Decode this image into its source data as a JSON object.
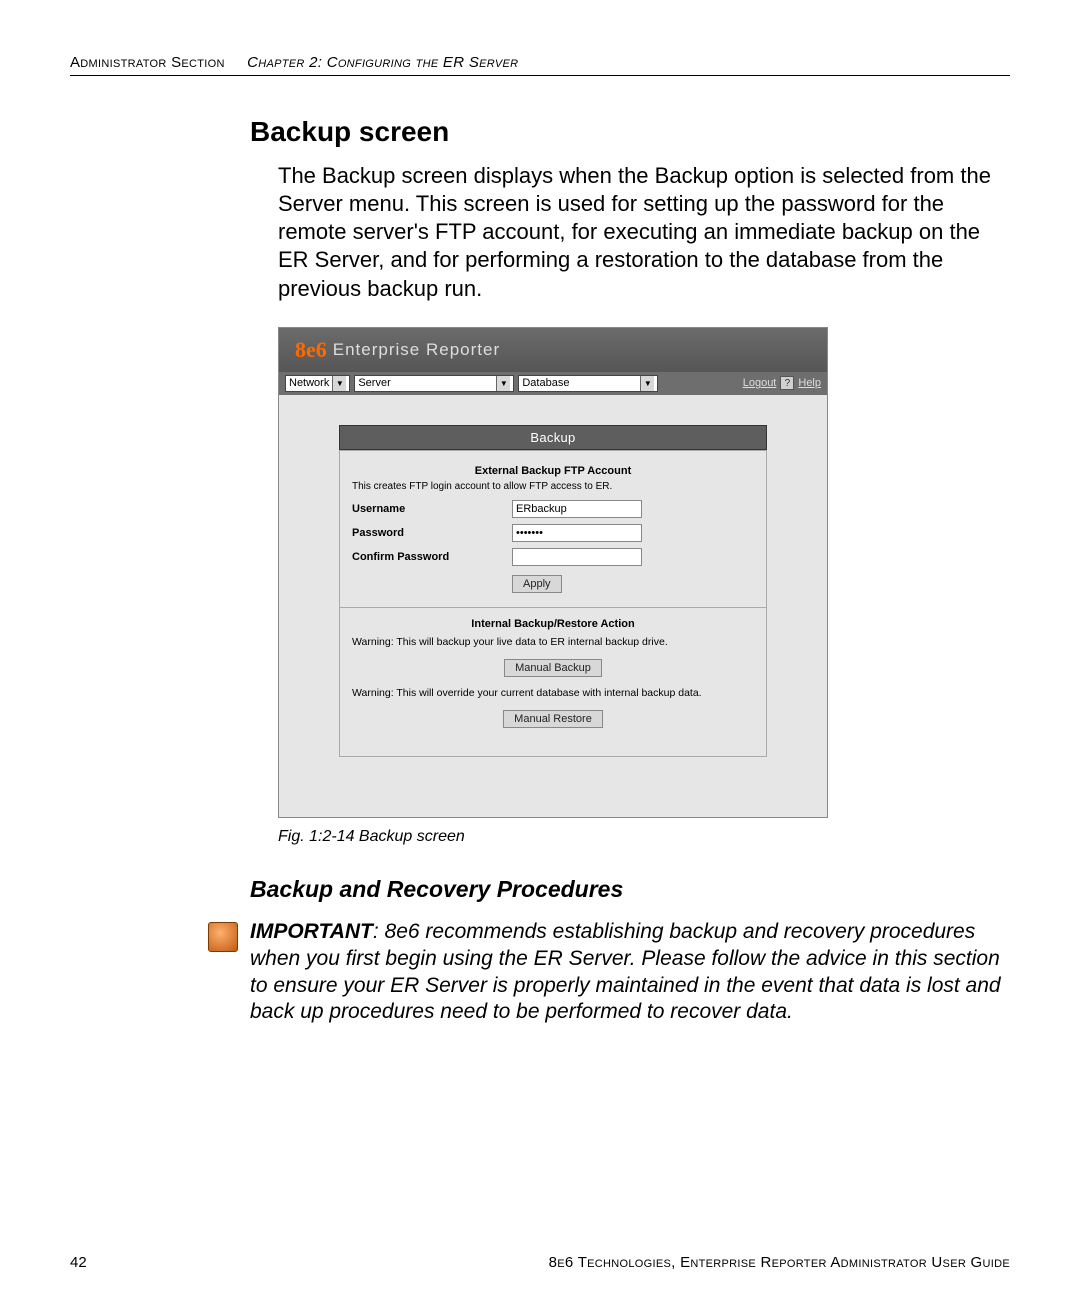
{
  "header": {
    "section": "Administrator Section",
    "chapter": "Chapter 2: Configuring the ER Server"
  },
  "title": "Backup screen",
  "intro": "The Backup screen displays when the Backup option is selected from the Server menu. This screen is used for setting up the password for the remote server's FTP account, for executing an immediate backup on the ER Server, and for performing a restoration to the database from the previous backup run.",
  "app": {
    "brand_prefix": "8e6",
    "brand_name": "Enterprise Reporter",
    "menus": {
      "network": "Network",
      "server": "Server",
      "database": "Database"
    },
    "links": {
      "logout": "Logout",
      "help": "Help",
      "q": "?"
    },
    "panel_title": "Backup",
    "ftp": {
      "section": "External Backup FTP Account",
      "desc": "This creates FTP login account to allow FTP access to ER.",
      "username_label": "Username",
      "username_value": "ERbackup",
      "password_label": "Password",
      "password_value": "•••••••",
      "confirm_label": "Confirm Password",
      "confirm_value": "",
      "apply": "Apply"
    },
    "restore": {
      "section": "Internal Backup/Restore Action",
      "warn1": "Warning: This will backup your live data to ER internal backup drive.",
      "manual_backup": "Manual Backup",
      "warn2": "Warning: This will override your current database with internal backup data.",
      "manual_restore": "Manual Restore"
    }
  },
  "caption": "Fig. 1:2-14  Backup screen",
  "subheading": "Backup and Recovery Procedures",
  "important_label": "IMPORTANT",
  "important_text": ": 8e6 recommends establishing backup and recovery procedures when you first begin using the ER Server. Please follow the advice in this section to ensure your ER Server is properly maintained in the event that data is lost and back up procedures need to be performed to recover data.",
  "footer": {
    "page": "42",
    "guide": "8e6 Technologies, Enterprise Reporter Administrator User Guide"
  }
}
